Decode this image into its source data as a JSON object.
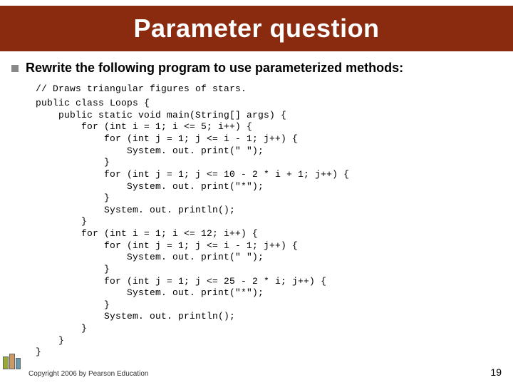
{
  "title": "Parameter question",
  "bullet": "Rewrite the following program to use parameterized methods:",
  "code_comment": "// Draws triangular figures of stars.",
  "code_body": "public class Loops {\n    public static void main(String[] args) {\n        for (int i = 1; i <= 5; i++) {\n            for (int j = 1; j <= i - 1; j++) {\n                System. out. print(\" \");\n            }\n            for (int j = 1; j <= 10 - 2 * i + 1; j++) {\n                System. out. print(\"*\");\n            }\n            System. out. println();\n        }\n        for (int i = 1; i <= 12; i++) {\n            for (int j = 1; j <= i - 1; j++) {\n                System. out. print(\" \");\n            }\n            for (int j = 1; j <= 25 - 2 * i; j++) {\n                System. out. print(\"*\");\n            }\n            System. out. println();\n        }\n    }\n}",
  "footer": "Copyright 2006 by Pearson Education",
  "pagenum": "19"
}
